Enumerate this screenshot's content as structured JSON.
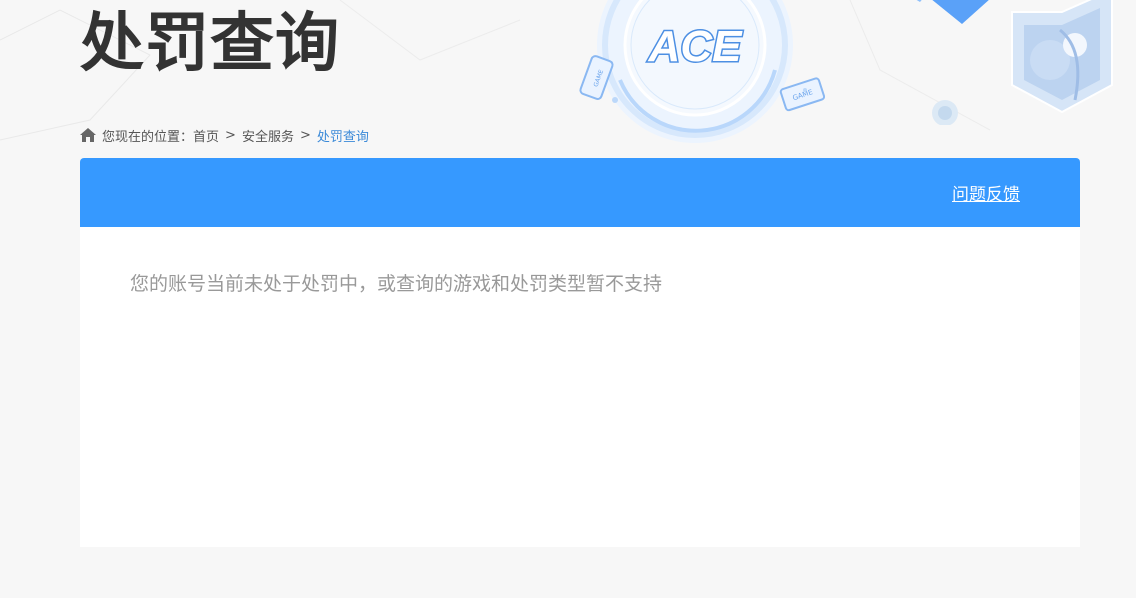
{
  "page": {
    "title": "处罚查询"
  },
  "breadcrumb": {
    "prefix": "您现在的位置：",
    "items": [
      "首页",
      "安全服务",
      "处罚查询"
    ],
    "separator": ">"
  },
  "emblem": {
    "logo_text": "ACE",
    "badge_text": "GAME"
  },
  "card": {
    "feedback_label": "问题反馈",
    "message": "您的账号当前未处于处罚中，或查询的游戏和处罚类型暂不支持"
  },
  "colors": {
    "accent": "#3699ff",
    "title": "#333333",
    "current_crumb": "#3b8ad8",
    "message": "#999999",
    "background": "#f7f7f7"
  },
  "icons": {
    "home": "home-icon"
  }
}
